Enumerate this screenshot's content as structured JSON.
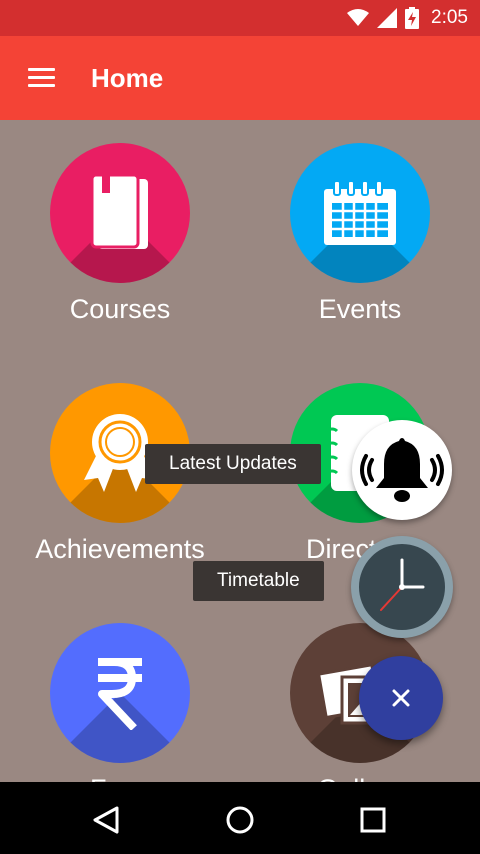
{
  "status_bar": {
    "time": "2:05",
    "icons": [
      "wifi-icon",
      "cell-signal-icon",
      "battery-charging-icon"
    ]
  },
  "app_bar": {
    "title": "Home",
    "menu_icon": "hamburger-menu-icon"
  },
  "tiles": [
    {
      "label": "Courses",
      "icon": "book-icon",
      "color": "#e91e63"
    },
    {
      "label": "Events",
      "icon": "calendar-icon",
      "color": "#03a9f4"
    },
    {
      "label": "Achievements",
      "icon": "award-ribbon-icon",
      "color": "#ff9800"
    },
    {
      "label": "Directory",
      "icon": "contacts-book-icon",
      "color": "#00c853"
    },
    {
      "label": "Fees",
      "icon": "rupee-icon",
      "color": "#536dfe"
    },
    {
      "label": "Gallery",
      "icon": "photos-icon",
      "color": "#5d4037"
    }
  ],
  "fab_menu": {
    "items": [
      {
        "label": "Latest Updates",
        "icon": "bell-icon"
      },
      {
        "label": "Timetable",
        "icon": "clock-icon"
      }
    ],
    "close_icon": "close-icon",
    "fab_color": "#303f9f"
  },
  "nav_bar": {
    "buttons": [
      "back-icon",
      "home-icon",
      "recents-icon"
    ]
  },
  "colors": {
    "status_bar": "#d32f2f",
    "app_bar": "#f44336",
    "background": "#9a8882"
  }
}
